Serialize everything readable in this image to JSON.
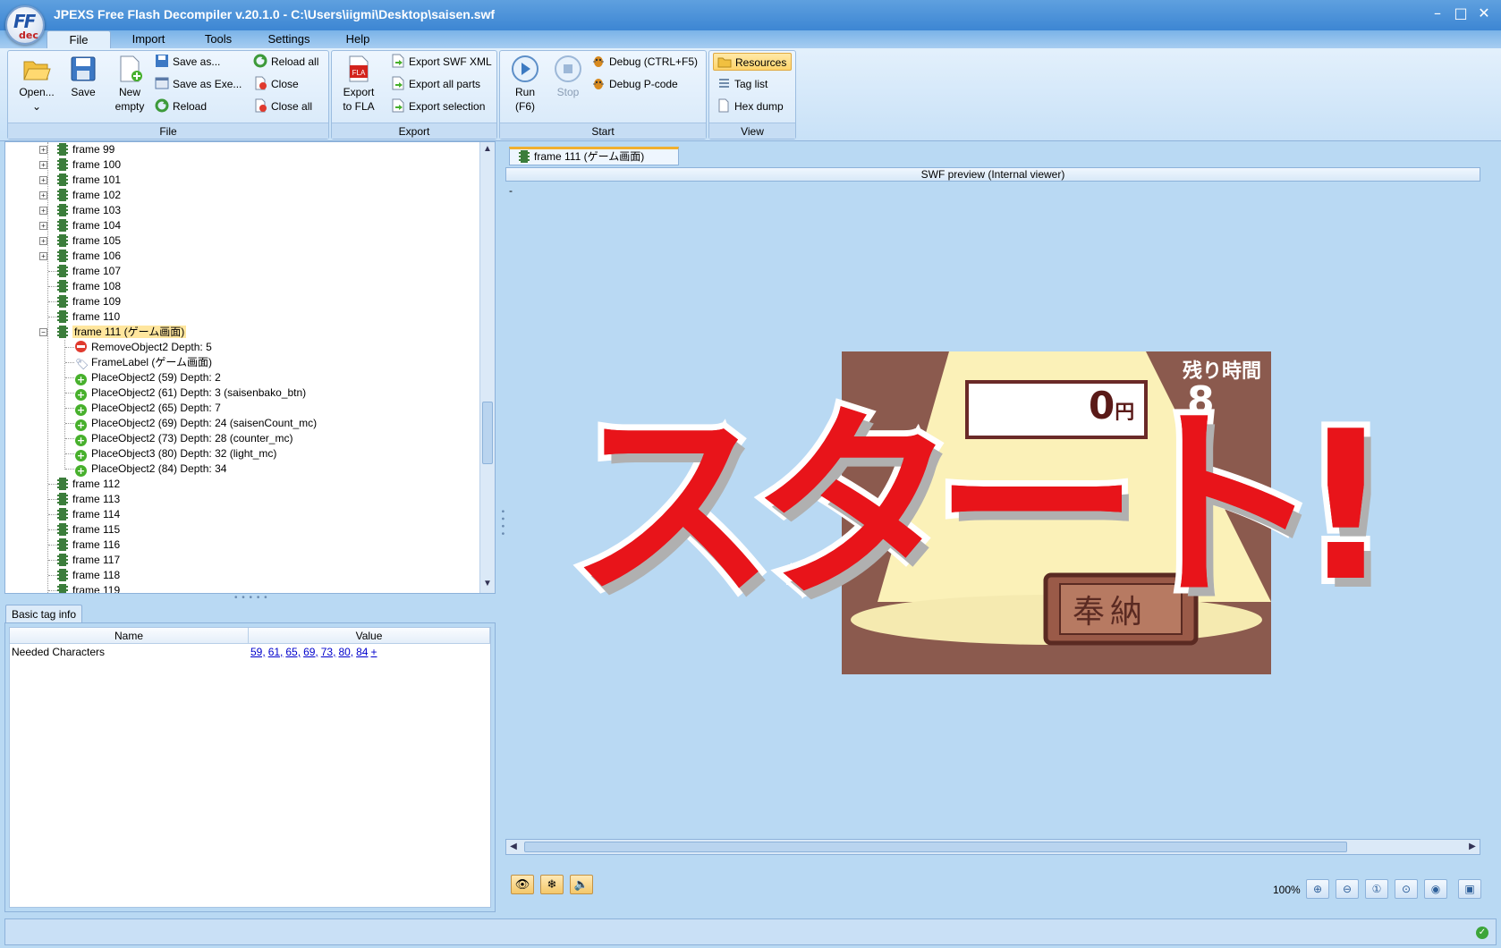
{
  "app": {
    "title": "JPEXS Free Flash Decompiler v.20.1.0 - C:\\Users\\iigmi\\Desktop\\saisen.swf",
    "logo_text_top": "FF",
    "logo_text_bottom": "dec"
  },
  "menu": {
    "tabs": [
      "File",
      "Import",
      "Tools",
      "Settings",
      "Help"
    ],
    "active": "File"
  },
  "ribbon": {
    "file_group": {
      "label": "File",
      "open": "Open...",
      "save": "Save",
      "new_empty_1": "New",
      "new_empty_2": "empty",
      "save_as": "Save as...",
      "save_as_exe": "Save as Exe...",
      "reload": "Reload",
      "reload_all": "Reload all",
      "close": "Close",
      "close_all": "Close all"
    },
    "export_group": {
      "label": "Export",
      "export_to_fla_1": "Export",
      "export_to_fla_2": "to FLA",
      "export_swf_xml": "Export SWF XML",
      "export_all_parts": "Export all parts",
      "export_selection": "Export selection"
    },
    "start_group": {
      "label": "Start",
      "run_1": "Run",
      "run_2": "(F6)",
      "stop": "Stop",
      "debug": "Debug (CTRL+F5)",
      "debug_pcode": "Debug P-code"
    },
    "view_group": {
      "label": "View",
      "resources": "Resources",
      "tag_list": "Tag list",
      "hex_dump": "Hex dump"
    }
  },
  "tree": {
    "frames_before": [
      "frame 99",
      "frame 100",
      "frame 101",
      "frame 102",
      "frame 103",
      "frame 104",
      "frame 105",
      "frame 106",
      "frame 107",
      "frame 108",
      "frame 109",
      "frame 110"
    ],
    "selected_frame": "frame 111 (ゲーム画面)",
    "children": [
      {
        "icon": "remove",
        "label": "RemoveObject2 Depth: 5"
      },
      {
        "icon": "label",
        "label": "FrameLabel (ゲーム画面)"
      },
      {
        "icon": "place",
        "label": "PlaceObject2 (59) Depth: 2"
      },
      {
        "icon": "place",
        "label": "PlaceObject2 (61) Depth: 3 (saisenbako_btn)"
      },
      {
        "icon": "place",
        "label": "PlaceObject2 (65) Depth: 7"
      },
      {
        "icon": "place",
        "label": "PlaceObject2 (69) Depth: 24 (saisenCount_mc)"
      },
      {
        "icon": "place",
        "label": "PlaceObject2 (73) Depth: 28 (counter_mc)"
      },
      {
        "icon": "place",
        "label": "PlaceObject3 (80) Depth: 32 (light_mc)"
      },
      {
        "icon": "place",
        "label": "PlaceObject2 (84) Depth: 34"
      }
    ],
    "frames_after": [
      "frame 112",
      "frame 113",
      "frame 114",
      "frame 115",
      "frame 116",
      "frame 117",
      "frame 118",
      "frame 119"
    ]
  },
  "taginfo": {
    "tab": "Basic tag info",
    "col_name": "Name",
    "col_value": "Value",
    "row_name": "Needed Characters",
    "row_links": [
      "59",
      "61",
      "65",
      "69",
      "73",
      "80",
      "84"
    ],
    "row_more": "+"
  },
  "preview": {
    "tab": "frame 111 (ゲーム画面)",
    "header": "SWF preview (Internal viewer)",
    "dash": "-",
    "zoom": "100%",
    "game": {
      "time_label": "残り時間",
      "time_value": "8",
      "money_value": "0",
      "money_unit": "円",
      "box_label": "奉納",
      "start_text": "スタート!"
    }
  },
  "colors": {
    "accent": "#3d86d3",
    "start_red": "#e8141a",
    "stage_bg": "#8b5a4e"
  }
}
